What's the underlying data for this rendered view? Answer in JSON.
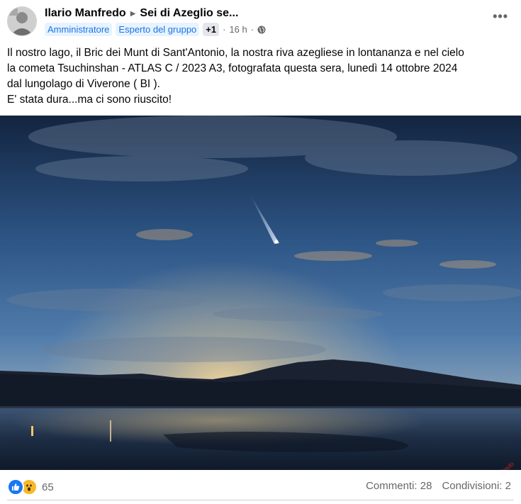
{
  "header": {
    "author": "Ilario Manfredo",
    "group": "Sei di Azeglio se...",
    "badges": [
      "Amministratore",
      "Esperto del gruppo"
    ],
    "extra_badge": "+1",
    "time": "16 h",
    "separator": "·",
    "menu": "•••"
  },
  "post": {
    "lines": [
      "Il nostro lago, il Bric dei Munt di Sant'Antonio, la nostra riva azegliese in lontananza e nel cielo",
      "la  cometa Tsuchinshan - ATLAS C / 2023 A3, fotografata questa sera, lunedì 14 ottobre 2024",
      "dal lungolago  di  Viverone ( BI ).",
      "E' stata dura...ma ci sono riuscito!"
    ]
  },
  "photo": {
    "signature": "Ilario Manfredo",
    "colors": {
      "sky_top": "#12233f",
      "sky_mid": "#3a6494",
      "glow": "#e7c98a",
      "water": "#18263a"
    }
  },
  "footer": {
    "reaction_count": "65",
    "comments": "Commenti: 28",
    "shares": "Condivisioni: 2"
  },
  "icons": {
    "reaction_1": "like-icon",
    "reaction_2": "wow-icon",
    "audience": "globe-icon",
    "menu": "more-icon"
  }
}
